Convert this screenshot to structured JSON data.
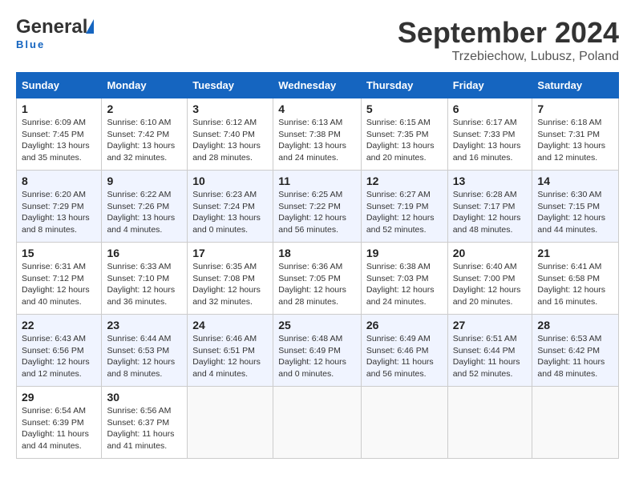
{
  "header": {
    "logo_line1": "General",
    "logo_line2": "Blue",
    "month": "September 2024",
    "location": "Trzebiechow, Lubusz, Poland"
  },
  "weekdays": [
    "Sunday",
    "Monday",
    "Tuesday",
    "Wednesday",
    "Thursday",
    "Friday",
    "Saturday"
  ],
  "weeks": [
    [
      {
        "day": "1",
        "sunrise": "6:09 AM",
        "sunset": "7:45 PM",
        "daylight": "13 hours and 35 minutes."
      },
      {
        "day": "2",
        "sunrise": "6:10 AM",
        "sunset": "7:42 PM",
        "daylight": "13 hours and 32 minutes."
      },
      {
        "day": "3",
        "sunrise": "6:12 AM",
        "sunset": "7:40 PM",
        "daylight": "13 hours and 28 minutes."
      },
      {
        "day": "4",
        "sunrise": "6:13 AM",
        "sunset": "7:38 PM",
        "daylight": "13 hours and 24 minutes."
      },
      {
        "day": "5",
        "sunrise": "6:15 AM",
        "sunset": "7:35 PM",
        "daylight": "13 hours and 20 minutes."
      },
      {
        "day": "6",
        "sunrise": "6:17 AM",
        "sunset": "7:33 PM",
        "daylight": "13 hours and 16 minutes."
      },
      {
        "day": "7",
        "sunrise": "6:18 AM",
        "sunset": "7:31 PM",
        "daylight": "13 hours and 12 minutes."
      }
    ],
    [
      {
        "day": "8",
        "sunrise": "6:20 AM",
        "sunset": "7:29 PM",
        "daylight": "13 hours and 8 minutes."
      },
      {
        "day": "9",
        "sunrise": "6:22 AM",
        "sunset": "7:26 PM",
        "daylight": "13 hours and 4 minutes."
      },
      {
        "day": "10",
        "sunrise": "6:23 AM",
        "sunset": "7:24 PM",
        "daylight": "13 hours and 0 minutes."
      },
      {
        "day": "11",
        "sunrise": "6:25 AM",
        "sunset": "7:22 PM",
        "daylight": "12 hours and 56 minutes."
      },
      {
        "day": "12",
        "sunrise": "6:27 AM",
        "sunset": "7:19 PM",
        "daylight": "12 hours and 52 minutes."
      },
      {
        "day": "13",
        "sunrise": "6:28 AM",
        "sunset": "7:17 PM",
        "daylight": "12 hours and 48 minutes."
      },
      {
        "day": "14",
        "sunrise": "6:30 AM",
        "sunset": "7:15 PM",
        "daylight": "12 hours and 44 minutes."
      }
    ],
    [
      {
        "day": "15",
        "sunrise": "6:31 AM",
        "sunset": "7:12 PM",
        "daylight": "12 hours and 40 minutes."
      },
      {
        "day": "16",
        "sunrise": "6:33 AM",
        "sunset": "7:10 PM",
        "daylight": "12 hours and 36 minutes."
      },
      {
        "day": "17",
        "sunrise": "6:35 AM",
        "sunset": "7:08 PM",
        "daylight": "12 hours and 32 minutes."
      },
      {
        "day": "18",
        "sunrise": "6:36 AM",
        "sunset": "7:05 PM",
        "daylight": "12 hours and 28 minutes."
      },
      {
        "day": "19",
        "sunrise": "6:38 AM",
        "sunset": "7:03 PM",
        "daylight": "12 hours and 24 minutes."
      },
      {
        "day": "20",
        "sunrise": "6:40 AM",
        "sunset": "7:00 PM",
        "daylight": "12 hours and 20 minutes."
      },
      {
        "day": "21",
        "sunrise": "6:41 AM",
        "sunset": "6:58 PM",
        "daylight": "12 hours and 16 minutes."
      }
    ],
    [
      {
        "day": "22",
        "sunrise": "6:43 AM",
        "sunset": "6:56 PM",
        "daylight": "12 hours and 12 minutes."
      },
      {
        "day": "23",
        "sunrise": "6:44 AM",
        "sunset": "6:53 PM",
        "daylight": "12 hours and 8 minutes."
      },
      {
        "day": "24",
        "sunrise": "6:46 AM",
        "sunset": "6:51 PM",
        "daylight": "12 hours and 4 minutes."
      },
      {
        "day": "25",
        "sunrise": "6:48 AM",
        "sunset": "6:49 PM",
        "daylight": "12 hours and 0 minutes."
      },
      {
        "day": "26",
        "sunrise": "6:49 AM",
        "sunset": "6:46 PM",
        "daylight": "11 hours and 56 minutes."
      },
      {
        "day": "27",
        "sunrise": "6:51 AM",
        "sunset": "6:44 PM",
        "daylight": "11 hours and 52 minutes."
      },
      {
        "day": "28",
        "sunrise": "6:53 AM",
        "sunset": "6:42 PM",
        "daylight": "11 hours and 48 minutes."
      }
    ],
    [
      {
        "day": "29",
        "sunrise": "6:54 AM",
        "sunset": "6:39 PM",
        "daylight": "11 hours and 44 minutes."
      },
      {
        "day": "30",
        "sunrise": "6:56 AM",
        "sunset": "6:37 PM",
        "daylight": "11 hours and 41 minutes."
      },
      {
        "day": "",
        "sunrise": "",
        "sunset": "",
        "daylight": ""
      },
      {
        "day": "",
        "sunrise": "",
        "sunset": "",
        "daylight": ""
      },
      {
        "day": "",
        "sunrise": "",
        "sunset": "",
        "daylight": ""
      },
      {
        "day": "",
        "sunrise": "",
        "sunset": "",
        "daylight": ""
      },
      {
        "day": "",
        "sunrise": "",
        "sunset": "",
        "daylight": ""
      }
    ]
  ]
}
